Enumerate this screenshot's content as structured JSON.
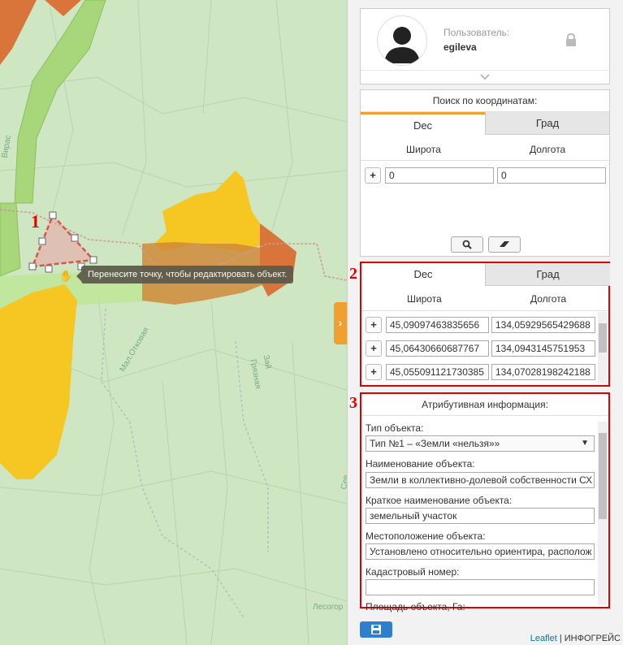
{
  "map": {
    "tooltip": "Перенесите точку, чтобы редактировать объект.",
    "annotations": [
      "1",
      "2",
      "3"
    ],
    "labels": [
      "Мал.Отковая",
      "Грязная",
      "Зай",
      "Лесогор",
      "Вирас",
      "Сев"
    ],
    "toggle_icon": "chevron-right-icon"
  },
  "user": {
    "label": "Пользователь:",
    "name": "egileva",
    "avatar_icon": "user-avatar-icon",
    "lock_icon": "lock-icon"
  },
  "coord_search": {
    "title": "Поиск по координатам:",
    "tabs": [
      "Dec",
      "Град"
    ],
    "col_lat": "Широта",
    "col_lon": "Долгота",
    "plus": "+",
    "lat_value": "0",
    "lon_value": "0"
  },
  "coord_list": {
    "tabs": [
      "Dec",
      "Град"
    ],
    "col_lat": "Широта",
    "col_lon": "Долгота",
    "rows": [
      {
        "plus": "+",
        "lat": "45,09097463835656",
        "lon": "134,05929565429688"
      },
      {
        "plus": "+",
        "lat": "45,06430660687767",
        "lon": "134,0943145751953"
      },
      {
        "plus": "+",
        "lat": "45,055091121730385",
        "lon": "134,07028198242188"
      }
    ]
  },
  "attributes": {
    "title": "Атрибутивная информация:",
    "object_type_label": "Тип объекта:",
    "object_type_value": "Тип №1 – «Земли «нельзя»»",
    "name_label": "Наименование объекта:",
    "name_value": "Земли в коллективно-долевой собственности СХ",
    "short_name_label": "Краткое наименование объекта:",
    "short_name_value": "земельный участок",
    "location_label": "Местоположение объекта:",
    "location_value": "Установлено относительно ориентира, располож",
    "cadastral_label": "Кадастровый номер:",
    "cadastral_value": "",
    "area_label": "Площадь объекта, Га:"
  },
  "footer": {
    "leaflet": "Leaflet",
    "separator": " | ",
    "brand": "ИНФОГРЕЙС"
  },
  "colors": {
    "accent": "#f0a030",
    "highlight": "#e00000",
    "save": "#2f7fd0",
    "map_bg": "#cfe6c2",
    "yellow_area": "#f6c623",
    "brown_area": "#cf8a3a"
  }
}
